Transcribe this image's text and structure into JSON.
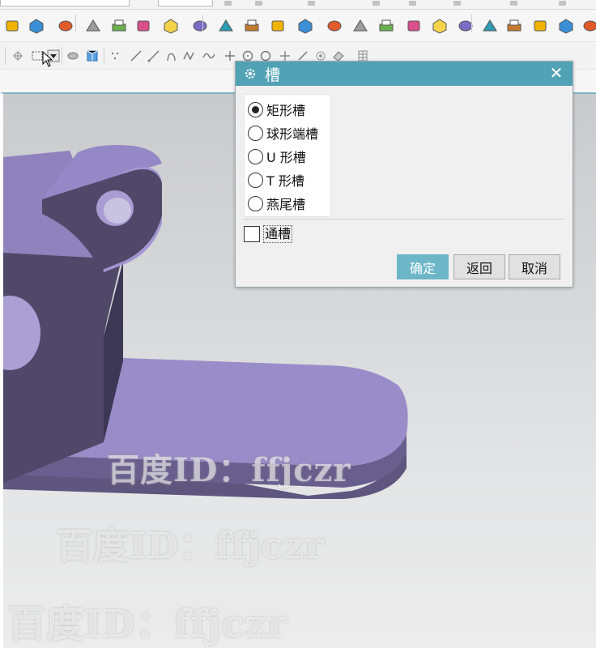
{
  "dialog": {
    "title": "槽",
    "title_icon": "gear-icon",
    "close_label": "✕",
    "slot_types": [
      {
        "label": "矩形槽",
        "selected": true
      },
      {
        "label": "球形端槽",
        "selected": false
      },
      {
        "label": "U 形槽",
        "selected": false
      },
      {
        "label": "T 形槽",
        "selected": false
      },
      {
        "label": "燕尾槽",
        "selected": false
      }
    ],
    "thru_slot": {
      "label": "通槽",
      "checked": false
    },
    "buttons": {
      "ok": "确定",
      "back": "返回",
      "cancel": "取消"
    }
  },
  "watermark": {
    "text": "百度ID：ffjczr"
  },
  "colors": {
    "title_bar": "#52a2b5",
    "ok_button": "#6cb6c8",
    "model_face": "#9a8cc8",
    "model_dark": "#4f4868",
    "viewport_top": "#c9cacd"
  },
  "toolbar": {
    "row1_icons": [
      "cylinder-icon",
      "pad-icon",
      "stairs-icon",
      "grid-icon",
      "boss-icon",
      "dots-icon",
      "feature-icon",
      "shape-add-icon",
      "book-icon",
      "box-icon",
      "stack-icon",
      "sweep-icon",
      "yellow-icon",
      "plate-icon",
      "block-icon",
      "cube-icon",
      "wire-cube-icon",
      "bend-icon",
      "blend-icon",
      "solid-cube-icon",
      "cylinders-icon",
      "surface-icon",
      "shell-icon",
      "pyramid-icon"
    ],
    "row2_icons": [
      "select-icon",
      "rect-select-icon",
      "dropdown-icon",
      "hide-icon",
      "view-cube-icon",
      "points-icon",
      "line-icon",
      "line2-icon",
      "arc-icon",
      "spline-icon",
      "curve-icon",
      "plus-icon",
      "circle-icon",
      "circle2-icon",
      "cross-icon",
      "slash-icon",
      "target-icon",
      "eraser-icon",
      "table-icon"
    ]
  }
}
